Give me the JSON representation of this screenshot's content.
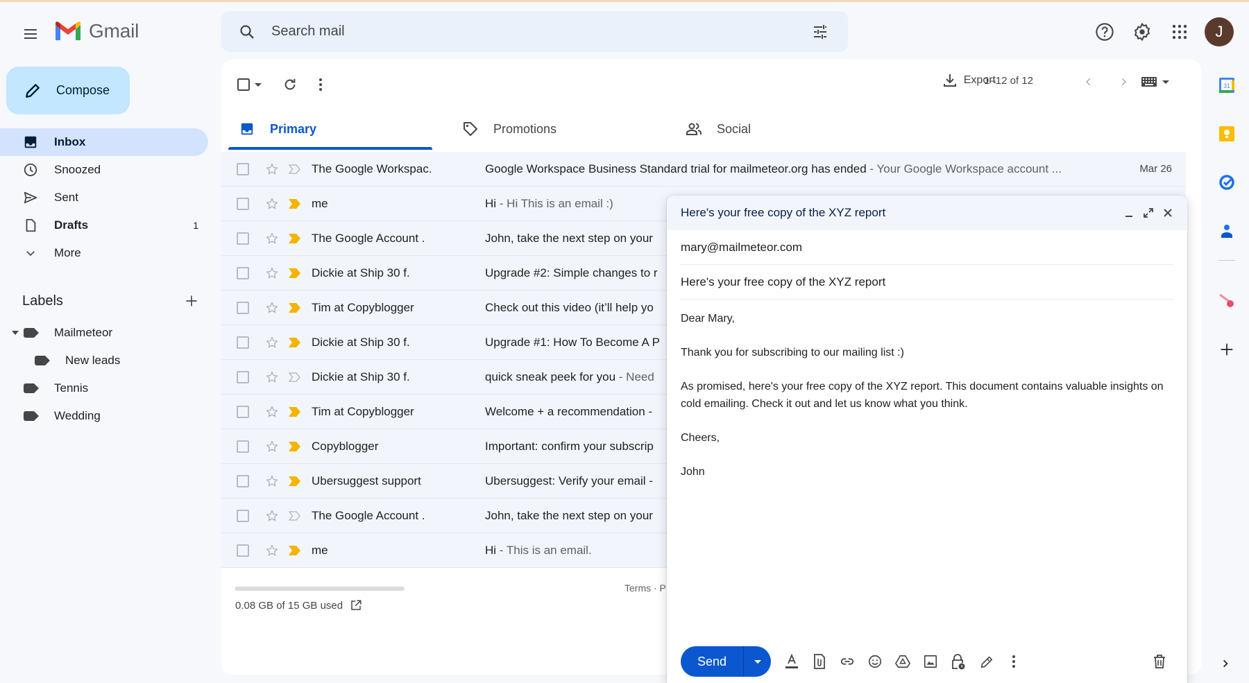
{
  "app": {
    "name": "Gmail"
  },
  "header": {
    "search_placeholder": "Search mail",
    "icons": [
      "help-icon",
      "settings-icon",
      "apps-icon"
    ],
    "avatar_initial": "J",
    "avatar_color": "#5b3a2e"
  },
  "compose_button": {
    "label": "Compose"
  },
  "nav": {
    "items": [
      {
        "label": "Inbox",
        "icon": "inbox-icon",
        "active": true,
        "count": ""
      },
      {
        "label": "Snoozed",
        "icon": "clock-icon",
        "count": ""
      },
      {
        "label": "Sent",
        "icon": "send-icon",
        "count": ""
      },
      {
        "label": "Drafts",
        "icon": "draft-icon",
        "count": "1",
        "bold": true
      },
      {
        "label": "More",
        "icon": "chevron-down-icon",
        "count": ""
      }
    ]
  },
  "labels": {
    "title": "Labels",
    "items": [
      {
        "label": "Mailmeteor",
        "expanded": true
      },
      {
        "label": "New leads",
        "child": true
      },
      {
        "label": "Tennis"
      },
      {
        "label": "Wedding"
      }
    ]
  },
  "toolbar": {
    "export_label": "Export",
    "pagination": "1–12 of 12"
  },
  "tabs": [
    {
      "label": "Primary",
      "icon": "inbox-icon",
      "active": true
    },
    {
      "label": "Promotions",
      "icon": "tag-icon"
    },
    {
      "label": "Social",
      "icon": "people-icon"
    }
  ],
  "emails": [
    {
      "sender": "The Google Workspac.",
      "subject": "Google Workspace Business Standard trial for mailmeteor.org has ended",
      "snippet": " - Your Google Workspace account ...",
      "date": "Mar 26",
      "important": false
    },
    {
      "sender": "me",
      "subject": "Hi",
      "snippet": " - Hi This is an email :)",
      "date": "",
      "important": true
    },
    {
      "sender": "The Google Account .",
      "subject": "John, take the next step on your",
      "snippet": "",
      "date": "",
      "important": true
    },
    {
      "sender": "Dickie at Ship 30 f.",
      "subject": "Upgrade #2: Simple changes to r",
      "snippet": "",
      "date": "",
      "important": true
    },
    {
      "sender": "Tim at Copyblogger",
      "subject": "Check out this video (it’ll help yo",
      "snippet": "",
      "date": "",
      "important": true
    },
    {
      "sender": "Dickie at Ship 30 f.",
      "subject": "Upgrade #1: How To Become A P",
      "snippet": "",
      "date": "",
      "important": true
    },
    {
      "sender": "Dickie at Ship 30 f.",
      "subject": "quick sneak peek for you",
      "snippet": " - Need",
      "date": "",
      "important": false
    },
    {
      "sender": "Tim at Copyblogger",
      "subject": "Welcome + a recommendation -",
      "snippet": "",
      "date": "",
      "important": true
    },
    {
      "sender": "Copyblogger",
      "subject": "Important: confirm your subscrip",
      "snippet": "",
      "date": "",
      "important": true
    },
    {
      "sender": "Ubersuggest support",
      "subject": "Ubersuggest: Verify your email -",
      "snippet": "",
      "date": "",
      "important": true
    },
    {
      "sender": "The Google Account .",
      "subject": "John, take the next step on your",
      "snippet": "",
      "date": "",
      "important": false
    },
    {
      "sender": "me",
      "subject": "Hi",
      "snippet": " - This is an email.",
      "date": "",
      "important": true
    }
  ],
  "storage": {
    "text": "0.08 GB of 15 GB used",
    "used_fraction": 0.0053
  },
  "footer": {
    "links_text": "Terms · P"
  },
  "side_apps": [
    "calendar-icon",
    "keep-icon",
    "tasks-icon",
    "contacts-icon",
    "mailmeteor-icon"
  ],
  "compose": {
    "title": "Here's your free copy of the XYZ report",
    "to": "mary@mailmeteor.com",
    "subject": "Here's your free copy of the XYZ report",
    "body": [
      "Dear Mary,",
      "Thank you for subscribing to our mailing list :)",
      "As promised, here's your free copy of the XYZ report. This document contains valuable insights on cold emailing. Check it out and let us know what you think.",
      "Cheers,",
      "John"
    ],
    "send_label": "Send"
  },
  "colors": {
    "accent": "#0b57d0",
    "important_marker": "#f4b400",
    "nav_active_bg": "#d3e3fd",
    "compose_btn_bg": "#c2e7ff"
  }
}
